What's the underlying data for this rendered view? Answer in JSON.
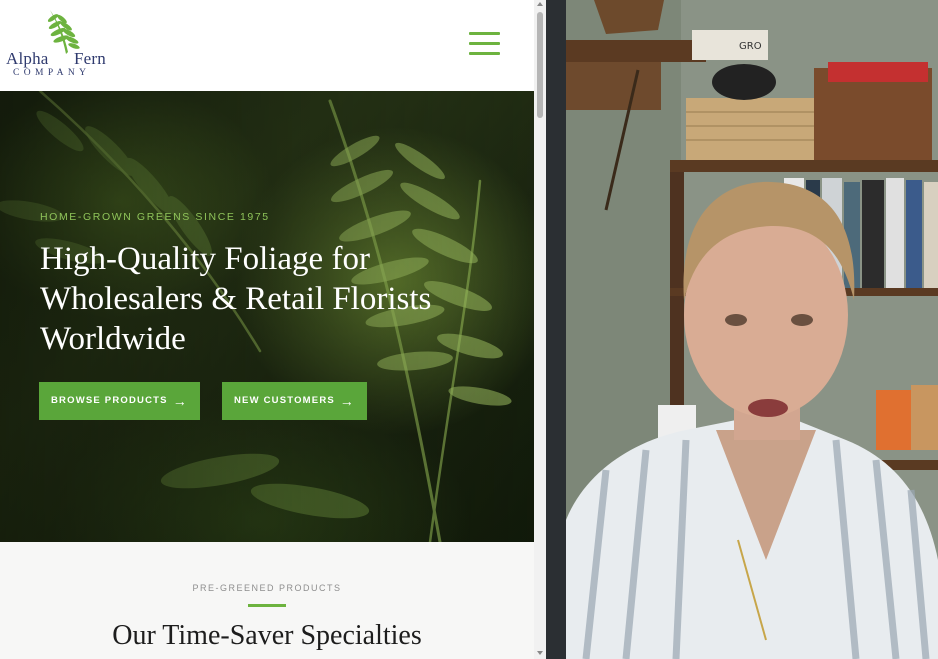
{
  "site": {
    "logo": {
      "word1": "Alpha",
      "word2": "Fern",
      "sub": "COMPANY"
    },
    "menu": {
      "icon": "hamburger-menu-icon"
    },
    "hero": {
      "eyebrow": "HOME-GROWN GREENS SINCE 1975",
      "headline_lines": [
        "High-Quality Foliage for",
        "Wholesalers & Retail Florists",
        "Worldwide"
      ],
      "buttons": [
        {
          "label": "BROWSE PRODUCTS",
          "icon": "arrow-right-icon",
          "arrow": "→"
        },
        {
          "label": "NEW CUSTOMERS",
          "icon": "arrow-right-icon",
          "arrow": "→"
        }
      ]
    },
    "specialties": {
      "eyebrow": "PRE-GREENED PRODUCTS",
      "title": "Our Time-Saver Specialties"
    }
  },
  "video": {
    "poster_text": "GRO",
    "participant": "webcam-participant"
  },
  "colors": {
    "brand_green": "#5aa63a",
    "logo_navy": "#2f3a6e",
    "divider": "#2b2f33"
  }
}
